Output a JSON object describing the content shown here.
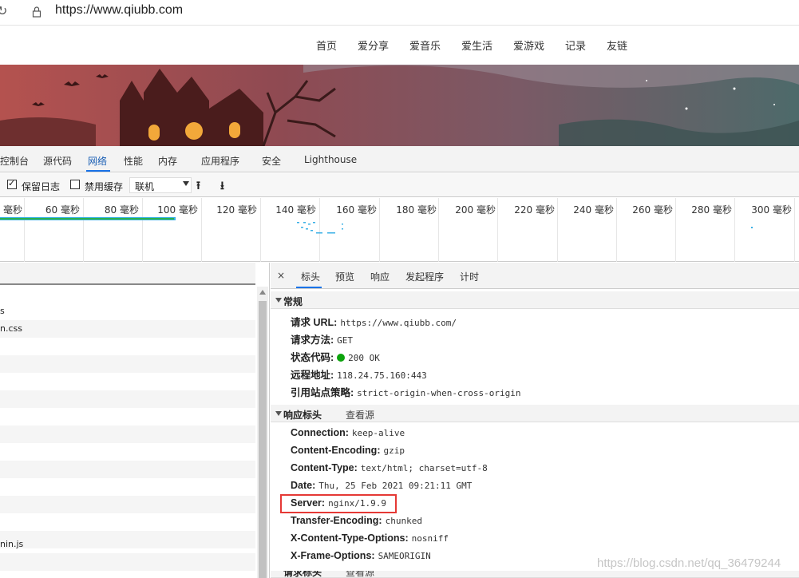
{
  "browser": {
    "url": "https://www.qiubb.com",
    "reload_glyph": "↻"
  },
  "site_nav": {
    "items": [
      "首页",
      "爱分享",
      "爱音乐",
      "爱生活",
      "爱游戏",
      "记录",
      "友链"
    ]
  },
  "devtools": {
    "tabs": [
      "控制台",
      "源代码",
      "网络",
      "性能",
      "内存",
      "应用程序",
      "安全",
      "Lighthouse"
    ],
    "active_tab": "网络",
    "toolbar": {
      "preserve_log_label": "保留日志",
      "preserve_log_checked": true,
      "disable_cache_label": "禁用缓存",
      "disable_cache_checked": false,
      "throttle_value": "联机",
      "upload_icon": "⭱",
      "download_icon": "⭳"
    },
    "timeline": {
      "ticks": [
        "毫秒",
        "60 毫秒",
        "80 毫秒",
        "100 毫秒",
        "120 毫秒",
        "140 毫秒",
        "160 毫秒",
        "180 毫秒",
        "200 毫秒",
        "220 毫秒",
        "240 毫秒",
        "260 毫秒",
        "280 毫秒",
        "300 毫秒"
      ]
    },
    "request_list": {
      "rows": [
        "s",
        "n.css",
        "",
        "",
        "",
        "",
        "",
        "",
        "",
        "",
        "",
        "",
        "",
        "",
        "nin.js",
        "",
        ""
      ]
    },
    "detail": {
      "close_glyph": "×",
      "tabs": [
        "标头",
        "预览",
        "响应",
        "发起程序",
        "计时"
      ],
      "active_tab": "标头",
      "general": {
        "title": "常规",
        "items": [
          {
            "key": "请求 URL:",
            "value": "https://www.qiubb.com/"
          },
          {
            "key": "请求方法:",
            "value": "GET"
          },
          {
            "key": "状态代码:",
            "value": "200 OK"
          },
          {
            "key": "远程地址:",
            "value": "118.24.75.160:443"
          },
          {
            "key": "引用站点策略:",
            "value": "strict-origin-when-cross-origin"
          }
        ]
      },
      "response_headers": {
        "title": "响应标头",
        "view_source": "查看源",
        "items": [
          {
            "key": "Connection:",
            "value": "keep-alive"
          },
          {
            "key": "Content-Encoding:",
            "value": "gzip"
          },
          {
            "key": "Content-Type:",
            "value": "text/html; charset=utf-8"
          },
          {
            "key": "Date:",
            "value": "Thu, 25 Feb 2021 09:21:11 GMT"
          },
          {
            "key": "Server:",
            "value": "nginx/1.9.9"
          },
          {
            "key": "Transfer-Encoding:",
            "value": "chunked"
          },
          {
            "key": "X-Content-Type-Options:",
            "value": "nosniff"
          },
          {
            "key": "X-Frame-Options:",
            "value": "SAMEORIGIN"
          }
        ]
      },
      "request_headers": {
        "title": "请求标头",
        "view_source": "查看源"
      }
    }
  },
  "watermark": "https://blog.csdn.net/qq_36479244",
  "colors": {
    "status_ok": "#0ca30c",
    "highlight": "#e53935",
    "accent": "#1a73e8"
  }
}
